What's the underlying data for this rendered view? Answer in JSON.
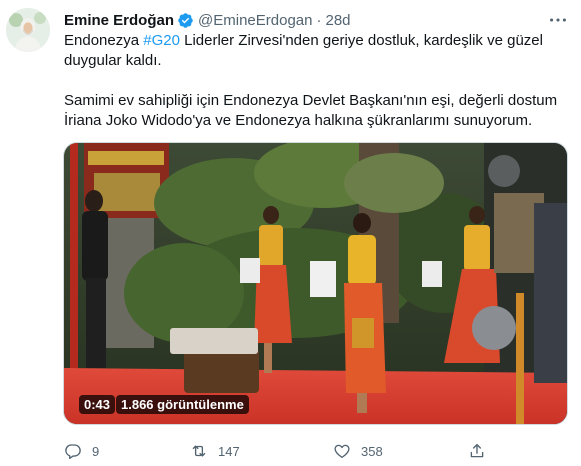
{
  "tweet": {
    "author_name": "Emine Erdoğan",
    "handle": "@EmineErdogan",
    "separator": "·",
    "time": "28d",
    "text_before_hashtag": "Endonezya ",
    "hashtag": "#G20",
    "text_after_hashtag": " Liderler Zirvesi'nden geriye dostluk, kardeşlik ve güzel duygular kaldı.",
    "text_paragraph_2": "Samimi ev sahipliği için Endonezya Devlet Başkanı'nın eşi, değerli dostum İriana Joko Widodo'ya ve Endonezya halkına şükranlarımı sunuyorum."
  },
  "video": {
    "duration": "0:43",
    "views": "1.866 görüntülenme"
  },
  "actions": {
    "reply_count": "9",
    "retweet_count": "147",
    "like_count": "358"
  },
  "colors": {
    "accent": "#1d9bf0",
    "secondary_text": "#536471",
    "primary_text": "#0f1419"
  },
  "icons": [
    "verified-badge-icon",
    "more-options-icon",
    "reply-icon",
    "retweet-icon",
    "like-icon",
    "share-icon"
  ]
}
